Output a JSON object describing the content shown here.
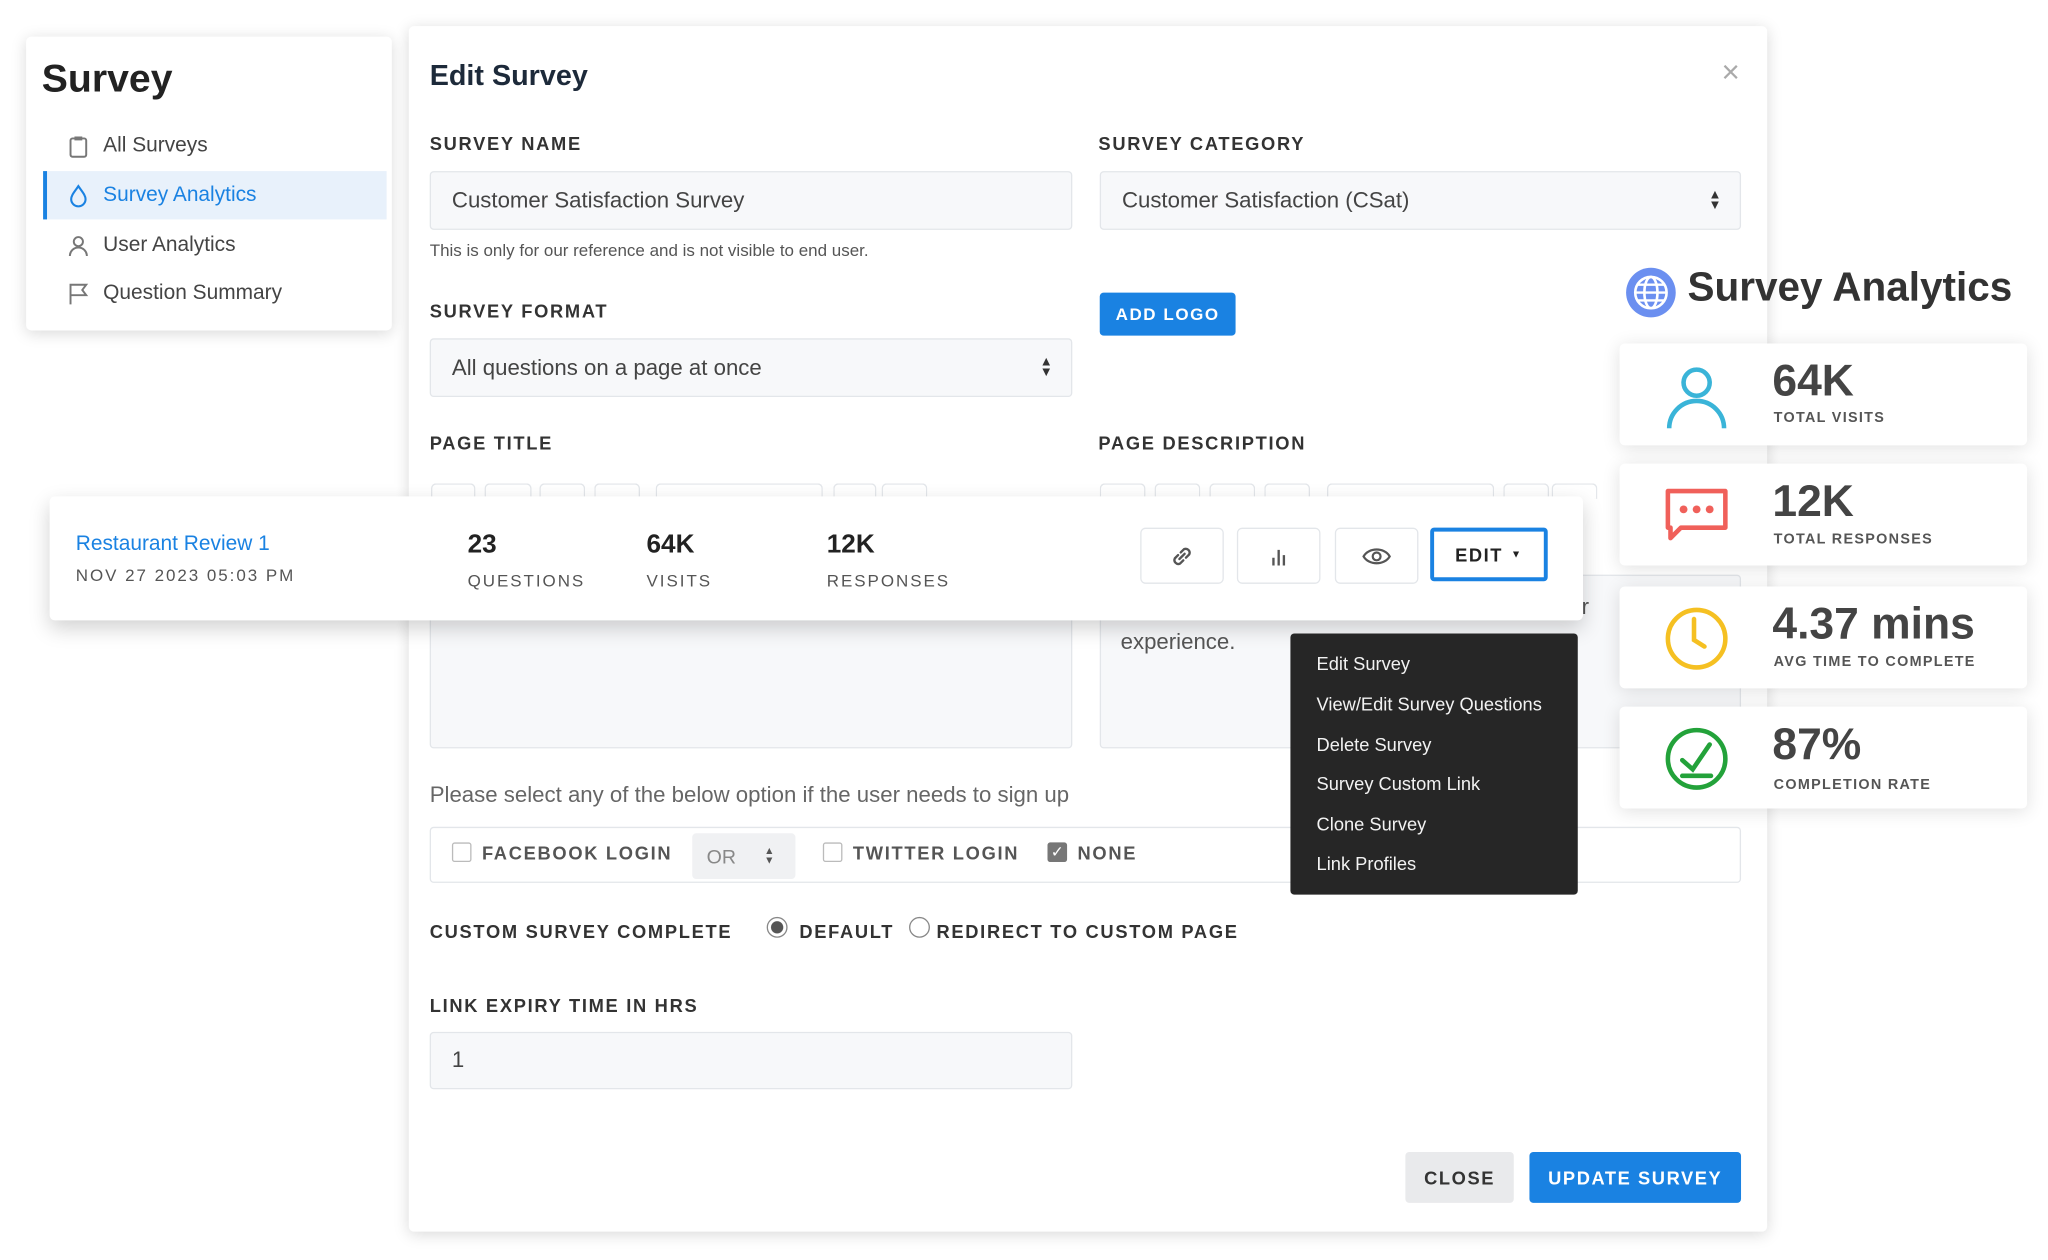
{
  "sidebar": {
    "title": "Survey",
    "items": [
      {
        "label": "All Surveys",
        "icon": "clipboard-icon"
      },
      {
        "label": "Survey Analytics",
        "icon": "droplet-icon",
        "active": true
      },
      {
        "label": "User Analytics",
        "icon": "user-icon"
      },
      {
        "label": "Question Summary",
        "icon": "flag-icon"
      }
    ]
  },
  "modal": {
    "title": "Edit Survey",
    "close_icon": "×",
    "survey_name": {
      "label": "SURVEY NAME",
      "value": "Customer Satisfaction Survey",
      "help": "This is only for our reference and is not visible to end user."
    },
    "survey_category": {
      "label": "SURVEY CATEGORY",
      "value": "Customer Satisfaction (CSat)"
    },
    "add_logo": "ADD LOGO",
    "survey_format": {
      "label": "SURVEY FORMAT",
      "value": "All questions on a page at once"
    },
    "page_title": {
      "label": "PAGE TITLE"
    },
    "page_description": {
      "label": "PAGE DESCRIPTION",
      "value_fragment": "experience.",
      "partial_char": "r"
    },
    "signup": {
      "prompt": "Please select any of the below option if the user needs to sign up",
      "facebook": {
        "label": "FACEBOOK LOGIN",
        "checked": false
      },
      "operator": "OR",
      "twitter": {
        "label": "TWITTER LOGIN",
        "checked": false
      },
      "none": {
        "label": "NONE",
        "checked": true
      }
    },
    "custom_complete": {
      "label": "CUSTOM SURVEY COMPLETE",
      "options": [
        {
          "label": "DEFAULT",
          "selected": true
        },
        {
          "label": "REDIRECT TO CUSTOM PAGE",
          "selected": false
        }
      ]
    },
    "link_expiry": {
      "label": "LINK EXPIRY TIME IN HRS",
      "value": "1"
    },
    "close_button": "CLOSE",
    "update_button": "UPDATE SURVEY"
  },
  "survey_row": {
    "name": "Restaurant Review 1",
    "date": "NOV 27 2023 05:03 PM",
    "stats": [
      {
        "value": "23",
        "label": "QUESTIONS"
      },
      {
        "value": "64K",
        "label": "VISITS"
      },
      {
        "value": "12K",
        "label": "RESPONSES"
      }
    ],
    "actions": {
      "link": "link-icon",
      "chart": "bar-chart-icon",
      "preview": "eye-icon",
      "edit": "EDIT"
    }
  },
  "edit_menu": [
    "Edit Survey",
    "View/Edit Survey Questions",
    "Delete Survey",
    "Survey Custom Link",
    "Clone Survey",
    "Link Profiles"
  ],
  "analytics": {
    "title": "Survey Analytics",
    "cards": [
      {
        "value": "64K",
        "label": "TOTAL VISITS",
        "icon": "user-icon",
        "color": "#3ab4d8"
      },
      {
        "value": "12K",
        "label": "TOTAL RESPONSES",
        "icon": "chat-bubble-icon",
        "color": "#f0605a"
      },
      {
        "value": "4.37 mins",
        "label": "AVG TIME TO COMPLETE",
        "icon": "clock-icon",
        "color": "#f5c022"
      },
      {
        "value": "87%",
        "label": "COMPLETION RATE",
        "icon": "check-circle-icon",
        "color": "#23a23a"
      }
    ]
  },
  "colors": {
    "accent": "#1a82e2",
    "menu_bg": "#262626"
  }
}
